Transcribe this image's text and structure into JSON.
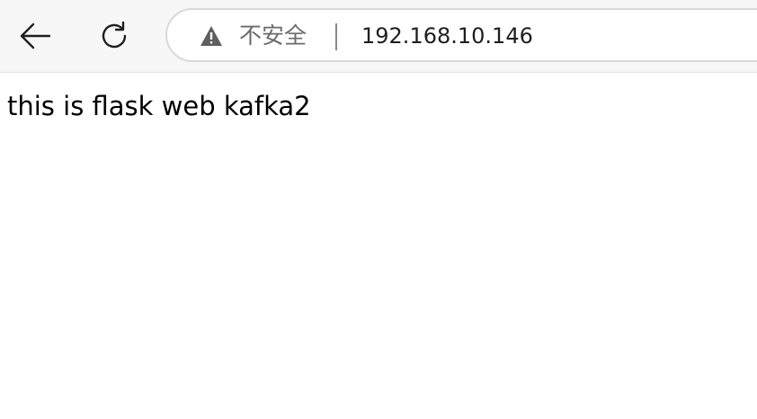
{
  "browser": {
    "toolbar": {
      "back_icon": "arrow-left-icon",
      "reload_icon": "reload-icon"
    },
    "address_bar": {
      "security_icon": "warning-icon",
      "security_label": "不安全",
      "url": "192.168.10.146"
    }
  },
  "page": {
    "body_text": "this is flask web kafka2"
  },
  "colors": {
    "toolbar_bg": "#f7f7f7",
    "address_bar_border": "#d9d9d9",
    "security_label": "#6b6b6b",
    "url_text": "#1f1f1f",
    "page_bg": "#ffffff"
  }
}
